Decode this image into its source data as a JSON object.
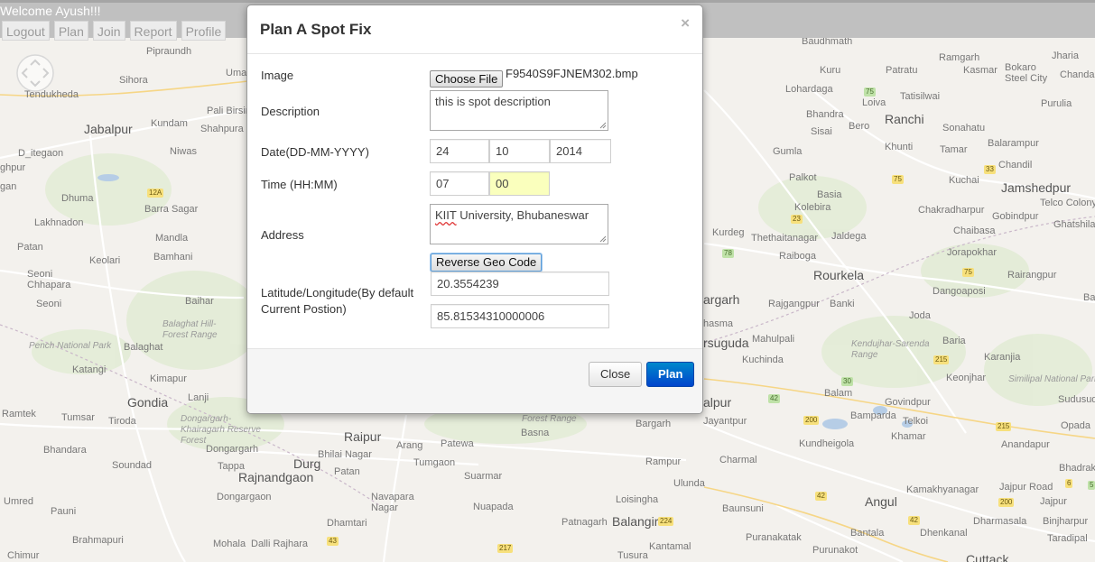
{
  "header": {
    "welcome": "Welcome Ayush!!!",
    "nav": [
      "Logout",
      "Plan",
      "Join",
      "Report",
      "Profile"
    ]
  },
  "map": {
    "places": [
      {
        "t": "Pipraundh"
      },
      {
        "t": "Umar"
      },
      {
        "t": "Sihora"
      },
      {
        "t": "Tendukheda"
      },
      {
        "t": "Pali Birsin"
      },
      {
        "t": "Jabalpur"
      },
      {
        "t": "Kundam"
      },
      {
        "t": "Shahpura"
      },
      {
        "t": "Niwas"
      },
      {
        "t": "D_itegaon"
      },
      {
        "t": "ghpur"
      },
      {
        "t": "gan"
      },
      {
        "t": "Dhuma"
      },
      {
        "t": "Barra Sagar"
      },
      {
        "t": "Lakhnadon"
      },
      {
        "t": "Mandla"
      },
      {
        "t": "Patan"
      },
      {
        "t": "Keolari"
      },
      {
        "t": "Bamhani"
      },
      {
        "t": "Seoni Chhapara"
      },
      {
        "t": "Seoni"
      },
      {
        "t": "Baihar"
      },
      {
        "t": "Pench National Park"
      },
      {
        "t": "Balaghat"
      },
      {
        "t": "Katangi"
      },
      {
        "t": "Kimapur"
      },
      {
        "t": "Lanji"
      },
      {
        "t": "Gondia"
      },
      {
        "t": "Ramtek"
      },
      {
        "t": "Tumsar"
      },
      {
        "t": "Tiroda"
      },
      {
        "t": "Bhandara"
      },
      {
        "t": "Dongargarh"
      },
      {
        "t": "Soundad"
      },
      {
        "t": "Tappa"
      },
      {
        "t": "Durg"
      },
      {
        "t": "Rajnandgaon"
      },
      {
        "t": "Patan"
      },
      {
        "t": "Bhilai Nagar"
      },
      {
        "t": "Raipur"
      },
      {
        "t": "Arang"
      },
      {
        "t": "Patewa"
      },
      {
        "t": "Tumgaon"
      },
      {
        "t": "Suarmar"
      },
      {
        "t": "Dongargaon"
      },
      {
        "t": "Umred"
      },
      {
        "t": "Pauni"
      },
      {
        "t": "Navapara Nagar"
      },
      {
        "t": "Nuapada"
      },
      {
        "t": "Dhamtari"
      },
      {
        "t": "Brahmapuri"
      },
      {
        "t": "Chimur"
      },
      {
        "t": "Mohala"
      },
      {
        "t": "Dalli Rajhara"
      },
      {
        "t": "Bargarh"
      },
      {
        "t": "Basna"
      },
      {
        "t": "Rampur"
      },
      {
        "t": "Ulunda"
      },
      {
        "t": "Loisingha"
      },
      {
        "t": "Patnagarh"
      },
      {
        "t": "Balangir"
      },
      {
        "t": "Tusura"
      },
      {
        "t": "Kantamal"
      },
      {
        "t": "Baunsuni"
      },
      {
        "t": "Charmal"
      },
      {
        "t": "Jayantpur"
      },
      {
        "t": "alpur"
      },
      {
        "t": "Kuchinda"
      },
      {
        "t": "Mahulpali"
      },
      {
        "t": "rsuguda"
      },
      {
        "t": "hasma"
      },
      {
        "t": "argarh"
      },
      {
        "t": "Rajgangpur"
      },
      {
        "t": "Banki"
      },
      {
        "t": "Rourkela"
      },
      {
        "t": "Raiboga"
      },
      {
        "t": "Thethaitanagar"
      },
      {
        "t": "Jaldega"
      },
      {
        "t": "Kurdeg"
      },
      {
        "t": "Kolebira"
      },
      {
        "t": "Basia"
      },
      {
        "t": "Palkot"
      },
      {
        "t": "Gumla"
      },
      {
        "t": "Sisai"
      },
      {
        "t": "Bero"
      },
      {
        "t": "Bhandra"
      },
      {
        "t": "Lohardaga"
      },
      {
        "t": "Kuru"
      },
      {
        "t": "Loiva"
      },
      {
        "t": "Ranchi"
      },
      {
        "t": "Tatisilwai"
      },
      {
        "t": "Patratu"
      },
      {
        "t": "Ramgarh"
      },
      {
        "t": "Kasmar"
      },
      {
        "t": "Bokaro Steel City"
      },
      {
        "t": "Jharia"
      },
      {
        "t": "Chandar"
      },
      {
        "t": "Purulia"
      },
      {
        "t": "Sonahatu"
      },
      {
        "t": "Khunti"
      },
      {
        "t": "Tamar"
      },
      {
        "t": "Balarampur"
      },
      {
        "t": "Chandil"
      },
      {
        "t": "Kuchai"
      },
      {
        "t": "Jamshedpur"
      },
      {
        "t": "Telco Colony"
      },
      {
        "t": "Chakradharpur"
      },
      {
        "t": "Gobindpur"
      },
      {
        "t": "Ghatshila"
      },
      {
        "t": "Chaibasa"
      },
      {
        "t": "Jorapokhar"
      },
      {
        "t": "Rairangpur"
      },
      {
        "t": "Dangoaposi"
      },
      {
        "t": "Joda"
      },
      {
        "t": "Barbil"
      },
      {
        "t": "Kendujhar-Sarenda Range"
      },
      {
        "t": "Baria"
      },
      {
        "t": "Karanjia"
      },
      {
        "t": "Keonjhar"
      },
      {
        "t": "Similipal National Park"
      },
      {
        "t": "Sudusud"
      },
      {
        "t": "Balam"
      },
      {
        "t": "Govindpur"
      },
      {
        "t": "Telkoi"
      },
      {
        "t": "Bamparda"
      },
      {
        "t": "Kundheigola"
      },
      {
        "t": "Khamar"
      },
      {
        "t": "Anandapur"
      },
      {
        "t": "Bhadrak"
      },
      {
        "t": "Kamakhyanagar"
      },
      {
        "t": "Jajpur Road"
      },
      {
        "t": "Jajpur"
      },
      {
        "t": "Angul"
      },
      {
        "t": "Dharmasala"
      },
      {
        "t": "Binjharpur"
      },
      {
        "t": "Dhenkanal"
      },
      {
        "t": "Bantala"
      },
      {
        "t": "Taradipal"
      },
      {
        "t": "Puranakatak"
      },
      {
        "t": "Purunakot"
      },
      {
        "t": "Cuttack"
      },
      {
        "t": "Balaghat Hill-Forest Range"
      },
      {
        "t": "Dongargarh-Khairagarh Reserve Forest"
      },
      {
        "t": "Forest Range"
      },
      {
        "t": "Opada"
      },
      {
        "t": "Baudhmath"
      }
    ],
    "shields": [
      "12A",
      "75",
      "33",
      "75",
      "23",
      "78",
      "75",
      "215",
      "200",
      "42",
      "42",
      "215",
      "200",
      "42",
      "224",
      "217",
      "43",
      "6",
      "30",
      "5"
    ]
  },
  "modal": {
    "title": "Plan A Spot Fix",
    "close_symbol": "×",
    "image_label": "Image",
    "choose_file_label": "Choose File",
    "file_name": "F9540S9FJNEM302.bmp",
    "description_label": "Description",
    "description_value": "this is spot description",
    "date_label": "Date(DD-MM-YYYY)",
    "date_day": "24",
    "date_month": "10",
    "date_year": "2014",
    "time_label": "Time (HH:MM)",
    "time_hours": "07",
    "time_minutes": "00",
    "address_label": "Address",
    "address_word1": "KIIT",
    "address_rest": " University, Bhubaneswar",
    "reverse_geocode_label": "Reverse Geo Code",
    "latlng_label_line1": "Latitude/Longitude(By default",
    "latlng_label_line2": "Current Postion)",
    "latitude": "20.3554239",
    "longitude": "85.81534310000006",
    "footer": {
      "close_label": "Close",
      "plan_label": "Plan"
    }
  },
  "colors": {
    "header_bg": "#c0c0c0",
    "plan_button": "#0055cc",
    "highlight_input": "#faffbd"
  }
}
